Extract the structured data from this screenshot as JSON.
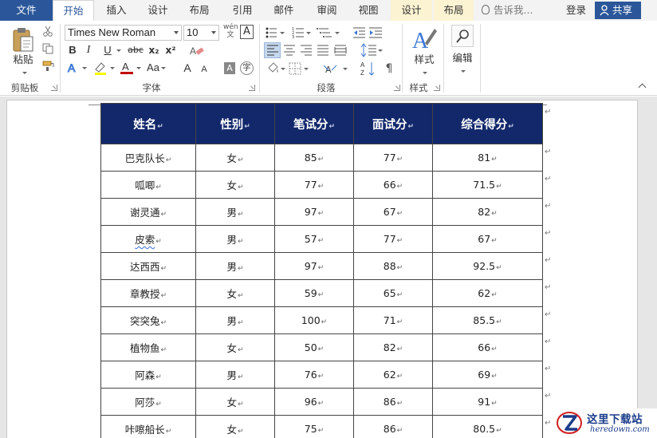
{
  "tabs": {
    "file": "文件",
    "home": "开始",
    "insert": "插入",
    "design": "设计",
    "layout": "布局",
    "references": "引用",
    "mailings": "邮件",
    "review": "审阅",
    "view": "视图",
    "table_design": "设计",
    "table_layout": "布局"
  },
  "tell_me": "告诉我...",
  "login": "登录",
  "share": "共享",
  "ribbon": {
    "clipboard": {
      "paste": "粘贴",
      "group_label": "剪贴板"
    },
    "font": {
      "font_name": "Times New Roman",
      "font_size": "10",
      "bold": "B",
      "italic": "I",
      "underline": "U",
      "strike": "abc",
      "subscript": "x₂",
      "superscript": "x²",
      "grow": "A",
      "shrink": "A",
      "aa": "Aa",
      "group_label": "字体"
    },
    "paragraph": {
      "group_label": "段落"
    },
    "styles": {
      "label": "样式",
      "group_label": "样式"
    },
    "editing": {
      "label": "编辑"
    }
  },
  "table": {
    "headers": [
      "姓名",
      "性别",
      "笔试分",
      "面试分",
      "综合得分"
    ],
    "rows": [
      [
        "巴克队长",
        "女",
        "85",
        "77",
        "81"
      ],
      [
        "呱唧",
        "女",
        "77",
        "66",
        "71.5"
      ],
      [
        "谢灵通",
        "男",
        "97",
        "67",
        "82"
      ],
      [
        "皮索",
        "男",
        "57",
        "77",
        "67"
      ],
      [
        "达西西",
        "男",
        "97",
        "88",
        "92.5"
      ],
      [
        "章教授",
        "女",
        "59",
        "65",
        "62"
      ],
      [
        "突突兔",
        "男",
        "100",
        "71",
        "85.5"
      ],
      [
        "植物鱼",
        "女",
        "50",
        "82",
        "66"
      ],
      [
        "阿森",
        "男",
        "76",
        "62",
        "69"
      ],
      [
        "阿莎",
        "女",
        "96",
        "86",
        "91"
      ],
      [
        "咔嚓船长",
        "女",
        "75",
        "86",
        "80.5"
      ]
    ]
  },
  "paragraph_mark": "↵",
  "watermark": {
    "title": "这里下载站",
    "url": "heredown.com"
  }
}
